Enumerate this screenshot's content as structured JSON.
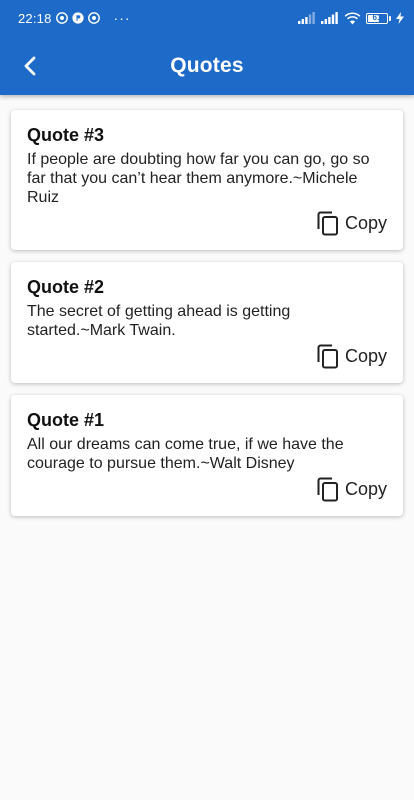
{
  "status_bar": {
    "time": "22:18",
    "notification_icons": [
      "chrome-icon",
      "p-badge-icon",
      "chrome-icon"
    ],
    "overflow": "···",
    "battery_level": "61"
  },
  "app_bar": {
    "title": "Quotes",
    "background_color": "#1e6ac8",
    "back_icon": "chevron-left-icon"
  },
  "quotes": [
    {
      "title": "Quote #3",
      "text": "If people are doubting how far you can go, go so far that you can’t hear them anymore.~Michele Ruiz",
      "copy_label": "Copy"
    },
    {
      "title": "Quote #2",
      "text": "The secret of getting ahead is getting started.~Mark Twain.",
      "copy_label": "Copy"
    },
    {
      "title": "Quote #1",
      "text": "All our dreams can come true, if we have the courage to pursue them.~Walt Disney",
      "copy_label": "Copy"
    }
  ]
}
